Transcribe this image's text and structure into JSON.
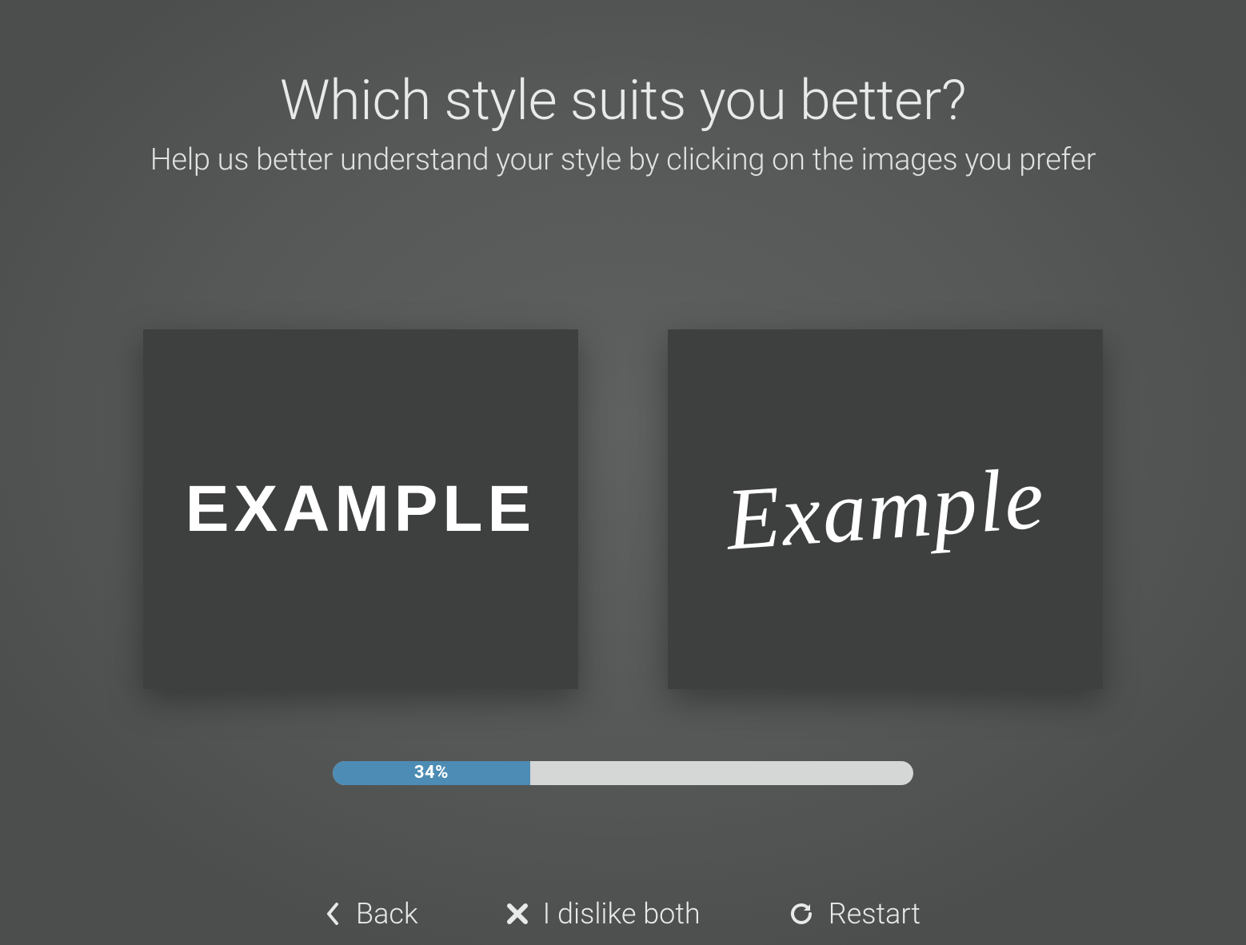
{
  "header": {
    "title": "Which style suits you better?",
    "subtitle": "Help us better understand your style by clicking on the images you prefer"
  },
  "choices": {
    "left_label": "EXAMPLE",
    "right_label": "Example"
  },
  "progress": {
    "percent": 34,
    "percent_label": "34%"
  },
  "controls": {
    "back": "Back",
    "dislike": "I dislike both",
    "restart": "Restart"
  },
  "colors": {
    "accent": "#4d8cb4",
    "card_bg": "#3e3f3f",
    "track": "#d5d6d6"
  }
}
